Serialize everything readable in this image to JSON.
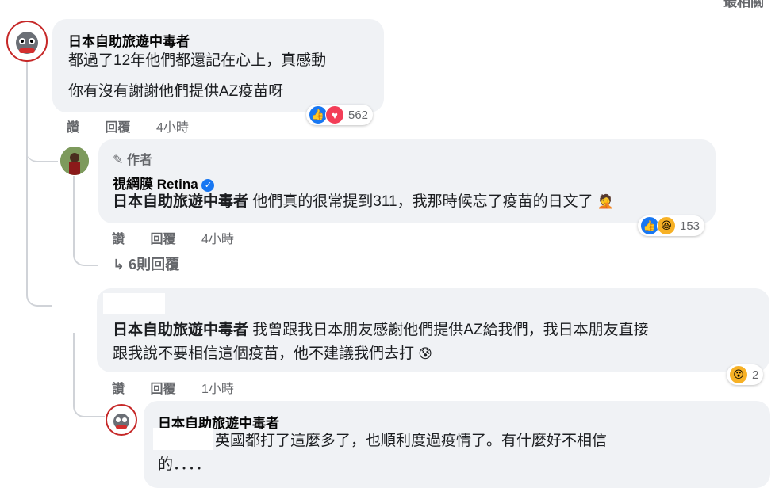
{
  "header": {
    "sort_label": "最相關"
  },
  "comment1": {
    "author": "日本自助旅遊中毒者",
    "line1": "都過了12年他們都還記在心上，真感動",
    "line2": "你有沒有謝謝他們提供AZ疫苗呀",
    "reaction_count": "562",
    "actions": {
      "like": "讚",
      "reply": "回覆",
      "time": "4小時"
    }
  },
  "reply1": {
    "author_badge": "作者",
    "author": "視網膜 Retina",
    "mention": "日本自助旅遊中毒者",
    "text": " 他們真的很常提到311，我那時候忘了疫苗的日文了",
    "reaction_count": "153",
    "actions": {
      "like": "讚",
      "reply": "回覆",
      "time": "4小時"
    },
    "more_replies": "6則回覆"
  },
  "comment2": {
    "mention": "日本自助旅遊中毒者",
    "line1": " 我曾跟我日本朋友感謝他們提供AZ給我們，我日本朋友直接",
    "line2": "跟我說不要相信這個疫苗，他不建議我們去打",
    "reaction_count": "2",
    "actions": {
      "like": "讚",
      "reply": "回覆",
      "time": "1小時"
    }
  },
  "reply2": {
    "author": "日本自助旅遊中毒者",
    "line1": "英國都打了這麼多了，也順利度過疫情了。有什麼好不相信",
    "line2": "的．．．．"
  },
  "icons": {
    "like": "like-icon",
    "love": "love-icon",
    "haha": "haha-icon",
    "wow": "wow-icon",
    "reply_arrow": "reply-arrow-icon",
    "pencil": "pencil-icon",
    "verified": "verified-badge-icon"
  },
  "colors": {
    "accent": "#1877f2",
    "bubble": "#f0f2f5",
    "meta": "#65676b"
  }
}
